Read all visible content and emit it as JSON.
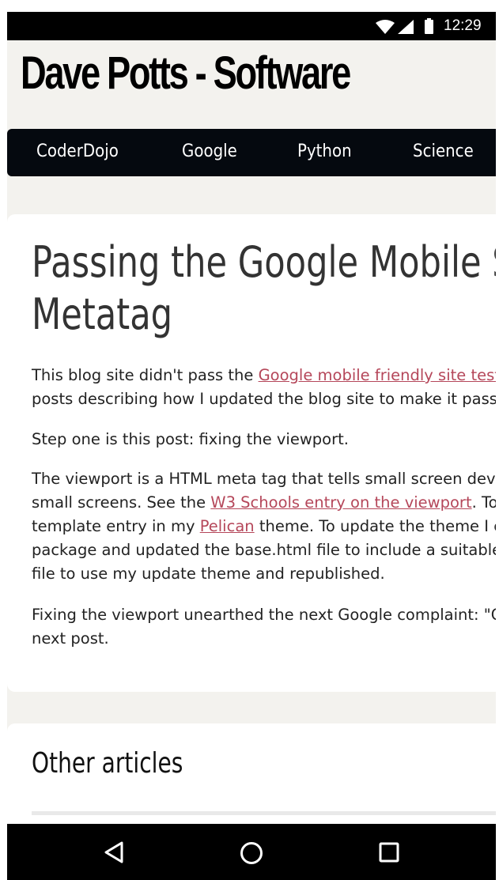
{
  "status_bar": {
    "time": "12:29"
  },
  "site": {
    "title": "Dave Potts - Software"
  },
  "nav": {
    "items": [
      "CoderDojo",
      "Google",
      "Python",
      "Science"
    ]
  },
  "post": {
    "title_lines": [
      "Passing the Google Mobile Site",
      "Metatag"
    ],
    "p1": {
      "before_link": "This blog site didn't pass the ",
      "link": "Google mobile friendly site test",
      "after_link": ".",
      "line2": "posts describing how I updated the blog site to make it pass."
    },
    "p2": "Step one is this post: fixing the viewport.",
    "p3": {
      "line1": "The viewport is a HTML meta tag that tells small screen device",
      "line2_before": "small screens. See the ",
      "line2_link": "W3 Schools entry on the viewport",
      "line2_after": ". To c",
      "line3_before": "template entry in my ",
      "line3_link": "Pelican",
      "line3_after": " theme. To update the theme I c",
      "line4": "package and updated the base.html file to include a suitable v",
      "line5": "file to use my update theme and republished."
    },
    "p4": {
      "line1": "Fixing the viewport unearthed the next Google complaint: \"Co",
      "line2": "next post."
    }
  },
  "other_articles": {
    "title": "Other articles"
  },
  "android_nav": {
    "back": "back-icon",
    "home": "home-icon",
    "recents": "recents-icon"
  },
  "colors": {
    "link": "#b5475a",
    "nav_bg": "#05090f",
    "page_bg": "#f3f2ee"
  }
}
